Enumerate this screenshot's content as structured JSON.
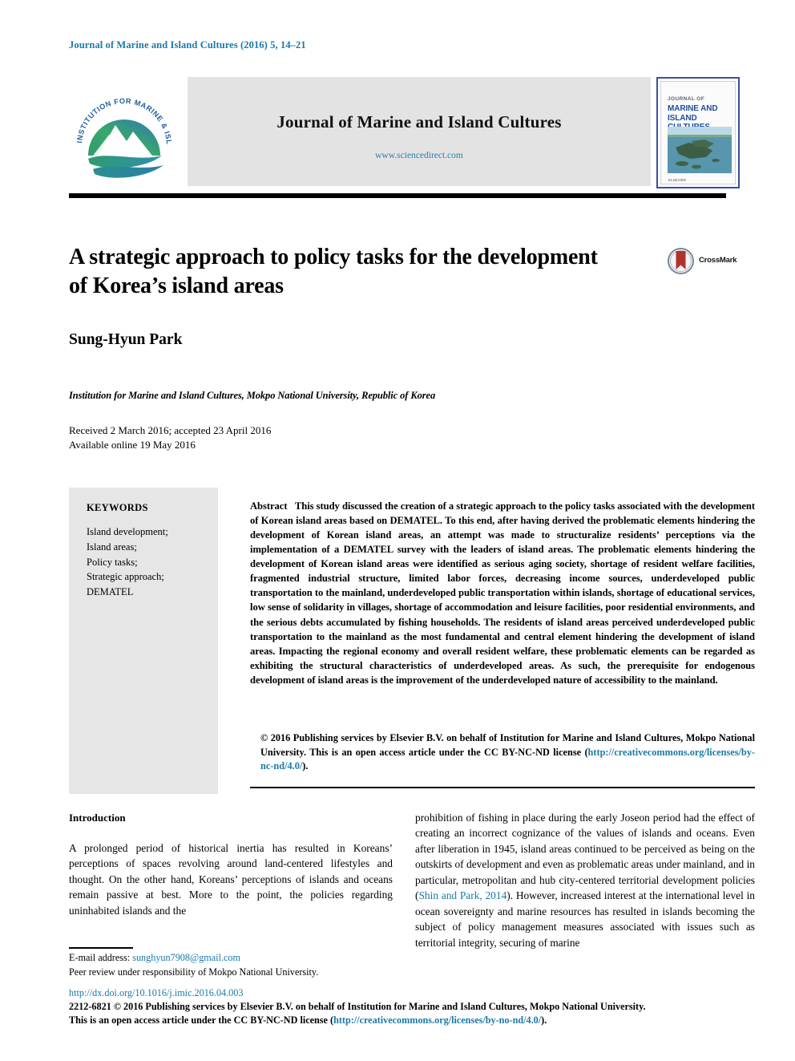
{
  "running_head": "Journal of Marine and Island Cultures (2016) 5, 14–21",
  "masthead": {
    "journal_title": "Journal of Marine and Island Cultures",
    "website": "www.sciencedirect.com",
    "logo_ring_text": "INSTITUTION FOR MARINE & ISLAND CULTURES",
    "cover": {
      "line_journal_of": "JOURNAL OF",
      "line_1": "MARINE AND",
      "line_2": "ISLAND CULTURES",
      "publisher": "ELSEVIER"
    }
  },
  "article": {
    "title": "A strategic approach to policy tasks for the development of Korea’s island areas",
    "crossmark_label": "CrossMark",
    "author": "Sung-Hyun Park",
    "affiliation": "Institution for Marine and Island Cultures, Mokpo National University, Republic of Korea",
    "received": "Received 2 March 2016; accepted 23 April 2016",
    "available": "Available online 19 May 2016"
  },
  "keywords": {
    "heading": "KEYWORDS",
    "items": "Island development;\nIsland areas;\nPolicy tasks;\nStrategic approach;\nDEMATEL"
  },
  "abstract": {
    "label": "Abstract",
    "text": "This study discussed the creation of a strategic approach to the policy tasks associated with the development of Korean island areas based on DEMATEL. To this end, after having derived the problematic elements hindering the development of Korean island areas, an attempt was made to structuralize residents’ perceptions via the implementation of a DEMATEL survey with the leaders of island areas. The problematic elements hindering the development of Korean island areas were identified as serious aging society, shortage of resident welfare facilities, fragmented industrial structure, limited labor forces, decreasing income sources, underdeveloped public transportation to the mainland, underdeveloped public transportation within islands, shortage of educational services, low sense of solidarity in villages, shortage of accommodation and leisure facilities, poor residential environments, and the serious debts accumulated by fishing households. The residents of island areas perceived underdeveloped public transportation to the mainland as the most fundamental and central element hindering the development of island areas. Impacting the regional economy and overall resident welfare, these problematic elements can be regarded as exhibiting the structural characteristics of underdeveloped areas. As such, the prerequisite for endogenous development of island areas is the improvement of the underdeveloped nature of accessibility to the mainland.",
    "copyright_line": "© 2016 Publishing services by Elsevier B.V. on behalf of Institution for Marine and Island Cultures, Mokpo National University. This is an open access article under the CC BY-NC-ND license (",
    "copyright_link": "http://creativecommons.org/licenses/by-nc-nd/4.0/",
    "copyright_tail": ")."
  },
  "body": {
    "section_heading": "Introduction",
    "left_column": "A prolonged period of historical inertia has resulted in Koreans’ perceptions of spaces revolving around land-centered lifestyles and thought. On the other hand, Koreans’ perceptions of islands and oceans remain passive at best. More to the point, the policies regarding uninhabited islands and the",
    "right_column_part1": "prohibition of fishing in place during the early Joseon period had the effect of creating an incorrect cognizance of the values of islands and oceans. Even after liberation in 1945, island areas continued to be perceived as being on the outskirts of development and even as problematic areas under mainland, and in particular, metropolitan and hub city-centered territorial development policies (",
    "right_column_citation": "Shin and Park, 2014",
    "right_column_part2": "). However, increased interest at the international level in ocean sovereignty and marine resources has resulted in islands becoming the subject of policy management measures associated with issues such as territorial integrity, securing of marine"
  },
  "footer": {
    "email_label": "E-mail address:",
    "email": "sunghyun7908@gmail.com",
    "peer_review": "Peer review under responsibility of Mokpo National University.",
    "doi": "http://dx.doi.org/10.1016/j.imic.2016.04.003",
    "issn_line": "2212-6821 © 2016 Publishing services by Elsevier B.V. on behalf of Institution for Marine and Island Cultures, Mokpo National University.",
    "license_prefix": "This is an open access article under the CC BY-NC-ND license (",
    "license_link": "http://creativecommons.org/licenses/by-no-nd/4.0/",
    "license_tail": ")."
  },
  "colors": {
    "link_blue": "#1a7aa8",
    "band_gray": "#e3e3e3",
    "keyword_gray": "#e6e6e6",
    "cover_border": "#3b4f9e",
    "crossmark_red": "#b2332a"
  }
}
